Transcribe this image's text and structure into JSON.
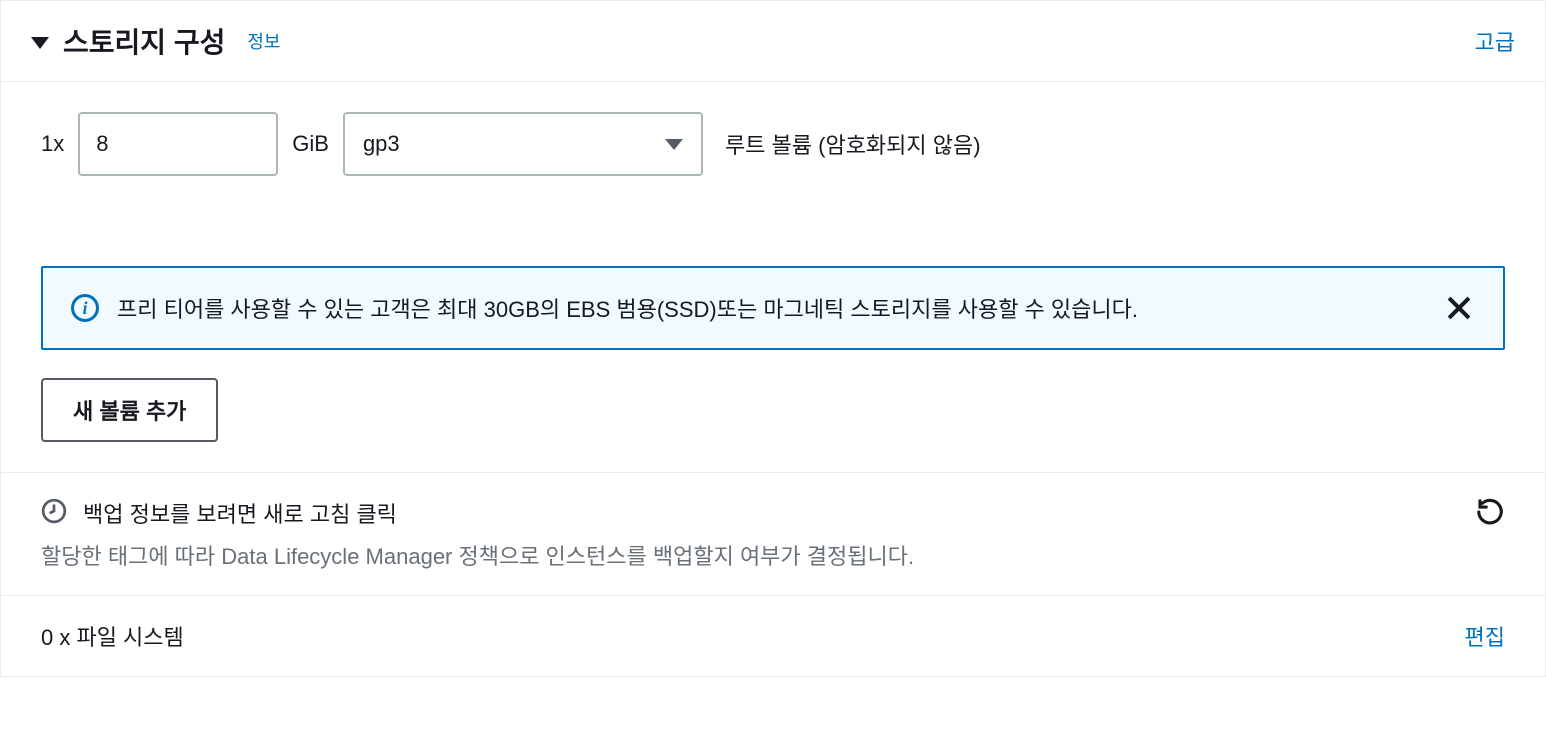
{
  "header": {
    "title": "스토리지 구성",
    "info_label": "정보",
    "advanced_label": "고급"
  },
  "volume": {
    "prefix": "1x",
    "size_value": "8",
    "unit": "GiB",
    "type_value": "gp3",
    "description": "루트 볼륨  (암호화되지 않음)"
  },
  "alert": {
    "message": "프리 티어를 사용할 수 있는 고객은 최대 30GB의 EBS 범용(SSD)또는 마그네틱 스토리지를 사용할 수 있습니다."
  },
  "add_volume_button": "새 볼륨 추가",
  "backup": {
    "title": "백업 정보를 보려면 새로 고침 클릭",
    "description": "할당한 태그에 따라 Data Lifecycle Manager 정책으로 인스턴스를 백업할지 여부가 결정됩니다."
  },
  "filesystem": {
    "label": "0 x 파일 시스템",
    "edit_label": "편집"
  }
}
